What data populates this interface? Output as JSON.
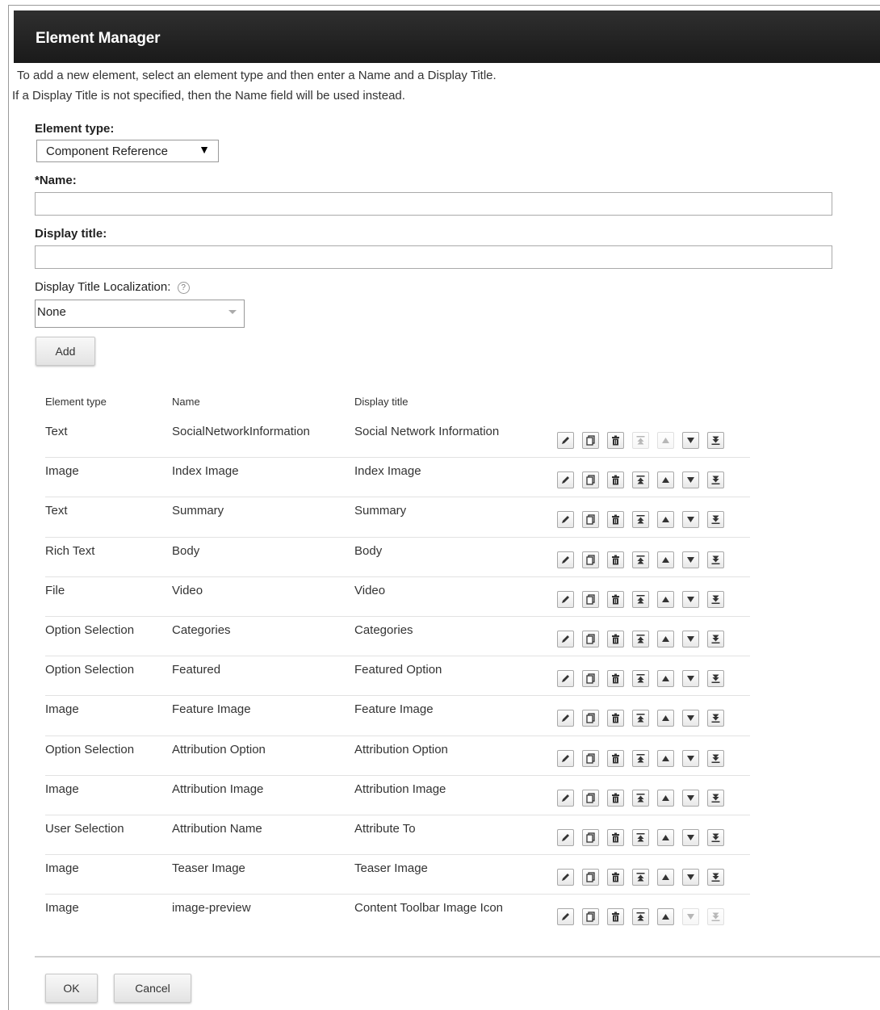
{
  "title": "Element Manager",
  "intro": {
    "line1": "To add a new element, select an element type and then enter a Name and a Display Title.",
    "line2": "If a Display Title is not specified, then the Name field will be used instead."
  },
  "form": {
    "element_type_label": "Element type:",
    "element_type_value": "Component Reference",
    "name_label": "*Name:",
    "name_value": "",
    "display_title_label": "Display title:",
    "display_title_value": "",
    "localization_label": "Display Title Localization:",
    "localization_value": "None",
    "add_label": "Add"
  },
  "table": {
    "headers": {
      "type": "Element type",
      "name": "Name",
      "display": "Display title"
    },
    "rows": [
      {
        "type": "Text",
        "name": "SocialNetworkInformation",
        "display": "Social Network Information"
      },
      {
        "type": "Image",
        "name": "Index Image",
        "display": "Index Image"
      },
      {
        "type": "Text",
        "name": "Summary",
        "display": "Summary"
      },
      {
        "type": "Rich Text",
        "name": "Body",
        "display": "Body"
      },
      {
        "type": "File",
        "name": "Video",
        "display": "Video"
      },
      {
        "type": "Option Selection",
        "name": "Categories",
        "display": "Categories"
      },
      {
        "type": "Option Selection",
        "name": "Featured",
        "display": "Featured Option"
      },
      {
        "type": "Image",
        "name": "Feature Image",
        "display": "Feature Image"
      },
      {
        "type": "Option Selection",
        "name": "Attribution Option",
        "display": "Attribution Option"
      },
      {
        "type": "Image",
        "name": "Attribution Image",
        "display": "Attribution Image"
      },
      {
        "type": "User Selection",
        "name": "Attribution Name",
        "display": "Attribute To"
      },
      {
        "type": "Image",
        "name": "Teaser Image",
        "display": "Teaser Image"
      },
      {
        "type": "Image",
        "name": "image-preview",
        "display": "Content Toolbar Image Icon"
      }
    ],
    "actions": [
      "edit-icon",
      "copy-icon",
      "delete-icon",
      "move-top-icon",
      "move-up-icon",
      "move-down-icon",
      "move-bottom-icon"
    ]
  },
  "footer": {
    "ok_label": "OK",
    "cancel_label": "Cancel"
  }
}
